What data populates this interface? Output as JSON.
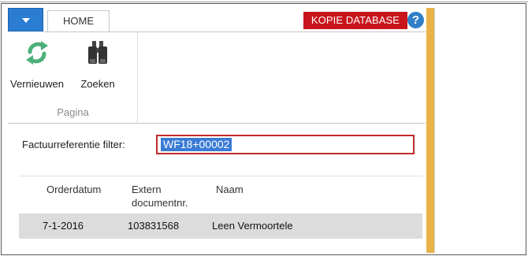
{
  "ribbon": {
    "app_menu": "",
    "tab_home": "HOME",
    "database_badge": "KOPIE DATABASE",
    "help": "?",
    "buttons": [
      {
        "label": "Vernieuwen",
        "icon": "refresh-icon"
      },
      {
        "label": "Zoeken",
        "icon": "binoculars-icon"
      }
    ],
    "group_label": "Pagina"
  },
  "filter": {
    "label": "Factuurreferentie filter:",
    "value": "WF18+00002"
  },
  "list": {
    "columns": [
      "Orderdatum",
      "Extern\ndocumentnr.",
      "Naam"
    ],
    "rows": [
      {
        "orderdatum": "7-1-2016",
        "extern_documentnr": "103831568",
        "naam": "Leen Vermoortele"
      }
    ]
  },
  "colors": {
    "accent_blue": "#2b7cd3",
    "badge_red": "#c8151c",
    "orange_bar": "#e9b34a",
    "refresh_green": "#4caf7a",
    "selection_blue": "#3a7bd5",
    "row_selected": "#dcdcdc"
  }
}
